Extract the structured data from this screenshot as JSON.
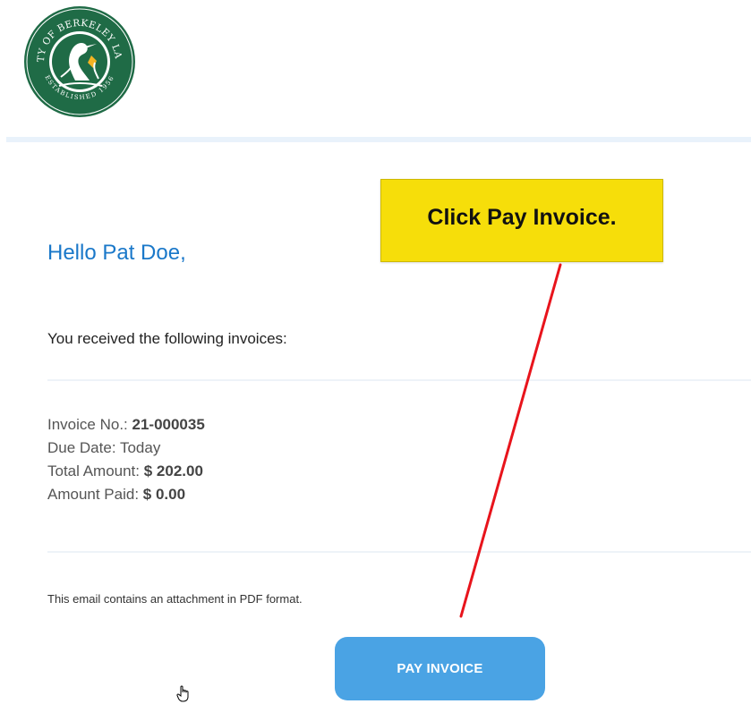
{
  "logo": {
    "text_top": "CITY OF BERKELEY LAKE",
    "text_bottom": "ESTABLISHED 1956",
    "colors": {
      "ring": "#1f6b46",
      "inner": "#ffffff",
      "accent": "#f4b322"
    }
  },
  "greeting": "Hello Pat Doe,",
  "intro": "You received the following invoices:",
  "invoice": {
    "number_label": "Invoice No.:",
    "number_value": "21-000035",
    "due_label": "Due Date:",
    "due_value": "Today",
    "total_label": "Total Amount:",
    "total_value": "$ 202.00",
    "paid_label": "Amount Paid:",
    "paid_value": "$ 0.00"
  },
  "attachment_note": "This email contains an attachment in PDF format.",
  "pay_button_label": "PAY INVOICE",
  "callout": {
    "text": "Click Pay Invoice.",
    "background": "#f6de0a",
    "arrow_color": "#e8141c"
  },
  "colors": {
    "greeting": "#1a78c9",
    "button": "#4aa3e4",
    "header_rule": "#e9f2fb"
  },
  "icons": {
    "cursor": "hand-pointer-icon"
  }
}
